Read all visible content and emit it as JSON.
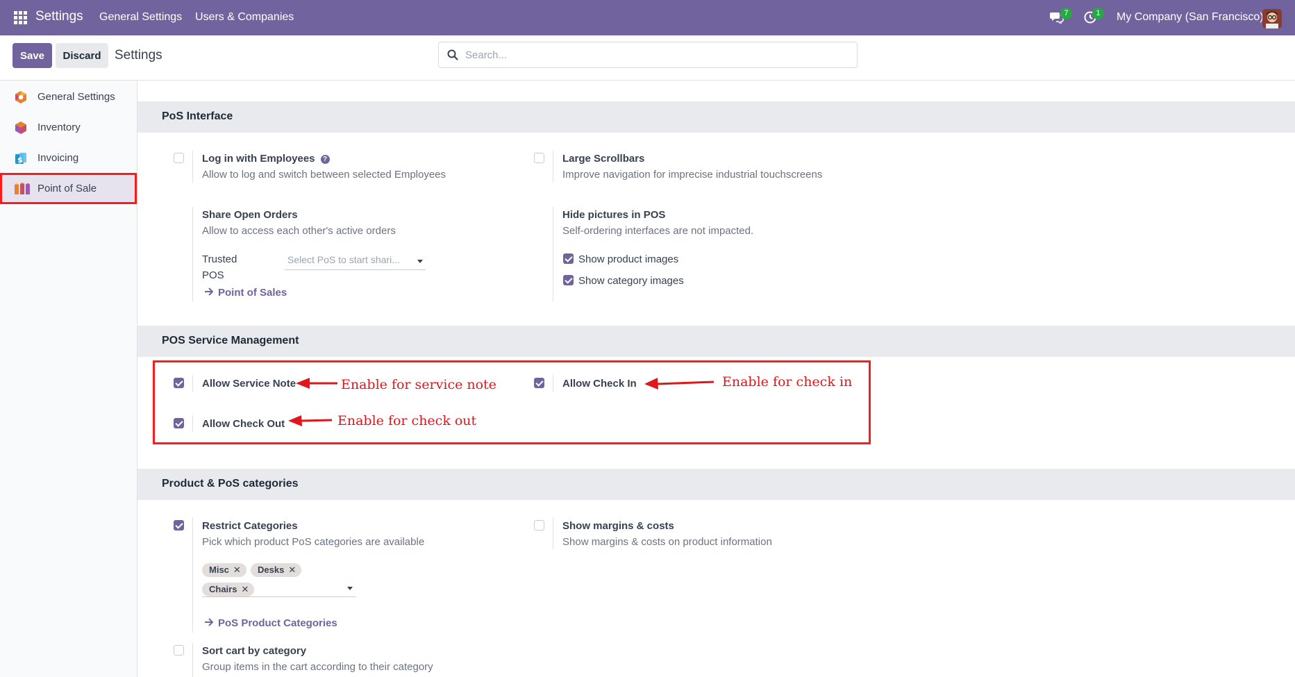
{
  "topbar": {
    "brand": "Settings",
    "menu": [
      "General Settings",
      "Users & Companies"
    ],
    "chat_count": "7",
    "activity_count": "1",
    "company": "My Company (San Francisco)"
  },
  "control": {
    "save_label": "Save",
    "discard_label": "Discard",
    "title": "Settings",
    "search_placeholder": "Search..."
  },
  "sidebar": {
    "items": [
      {
        "label": "General Settings",
        "icon": "general-settings-icon"
      },
      {
        "label": "Inventory",
        "icon": "inventory-icon"
      },
      {
        "label": "Invoicing",
        "icon": "invoicing-icon"
      },
      {
        "label": "Point of Sale",
        "icon": "point-of-sale-icon",
        "active": true
      }
    ]
  },
  "pos_interface": {
    "heading": "PoS Interface",
    "login_employees": {
      "title": "Log in with Employees",
      "desc": "Allow to log and switch between selected Employees",
      "checked": false
    },
    "large_scrollbars": {
      "title": "Large Scrollbars",
      "desc": "Improve navigation for imprecise industrial touchscreens",
      "checked": false
    },
    "share_orders": {
      "title": "Share Open Orders",
      "desc": "Allow to access each other's active orders",
      "trusted_label_1": "Trusted",
      "trusted_label_2": "POS",
      "select_placeholder": "Select PoS to start shari...",
      "link": "Point of Sales"
    },
    "hide_pictures": {
      "title": "Hide pictures in POS",
      "desc": "Self-ordering interfaces are not impacted.",
      "show_product_images": "Show product images",
      "show_category_images": "Show category images"
    }
  },
  "service_mgmt": {
    "heading": "POS Service Management",
    "service_note": {
      "title": "Allow Service Note",
      "checked": true
    },
    "check_in": {
      "title": "Allow Check In",
      "checked": true
    },
    "check_out": {
      "title": "Allow Check Out",
      "checked": true
    }
  },
  "categories": {
    "heading": "Product & PoS categories",
    "restrict": {
      "title": "Restrict Categories",
      "desc": "Pick which product PoS categories are available",
      "checked": true,
      "tags": [
        "Misc",
        "Desks",
        "Chairs"
      ],
      "link": "PoS Product Categories"
    },
    "margins": {
      "title": "Show margins & costs",
      "desc": "Show margins & costs on product information",
      "checked": false
    },
    "sort_cart": {
      "title": "Sort cart by category",
      "desc": "Group items in the cart according to their category",
      "checked": false
    }
  },
  "annotations": {
    "service_note": "Enable for service note",
    "check_in": "Enable for check in",
    "check_out": "Enable for check out"
  },
  "colors": {
    "brand": "#71639e",
    "highlight": "#ff1a1a",
    "annotation": "#e0161c"
  }
}
